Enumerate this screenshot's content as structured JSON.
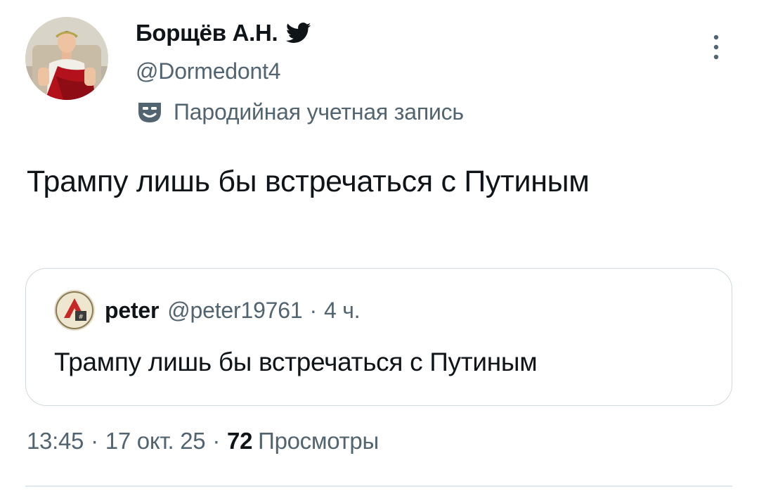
{
  "author": {
    "display_name": "Борщёв А.Н.",
    "handle": "@Dormedont4",
    "parody_label": "Пародийная учетная запись"
  },
  "tweet": {
    "text": "Трампу лишь бы встречаться с Путиным"
  },
  "quote": {
    "name": "peter",
    "handle": "@peter19761",
    "separator": "·",
    "time": "4 ч.",
    "text": "Трампу лишь бы встречаться с Путиным"
  },
  "meta": {
    "time": "13:45",
    "date": "17 окт. 25",
    "separator": "·",
    "views_count": "72",
    "views_label": "Просмотры"
  },
  "icons": {
    "verified": "twitter-bird-icon",
    "parody": "theater-mask-icon",
    "more": "more-vertical-icon"
  },
  "colors": {
    "text_primary": "#0f1419",
    "text_secondary": "#536471",
    "border": "#cfd9de"
  }
}
